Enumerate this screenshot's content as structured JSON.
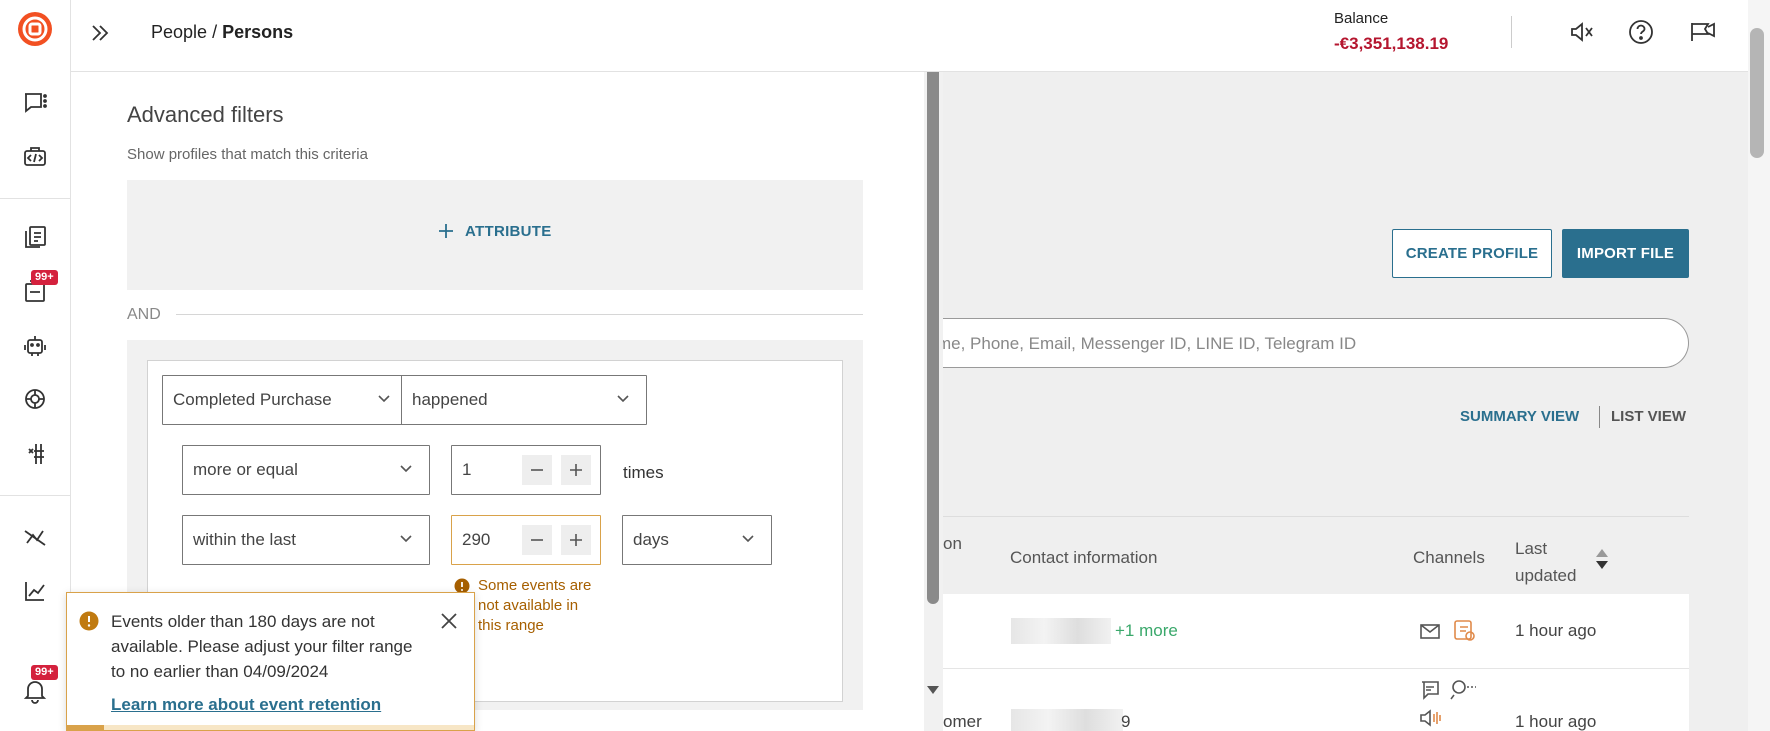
{
  "header": {
    "breadcrumb_parent": "People",
    "breadcrumb_sep": " / ",
    "breadcrumb_current": "Persons",
    "balance_label": "Balance",
    "balance_value": "-€3,351,138.19"
  },
  "rail": {
    "badges": [
      "99+",
      "99+"
    ]
  },
  "main": {
    "create_profile": "CREATE PROFILE",
    "import_file": "IMPORT FILE",
    "search_placeholder": "me, Phone, Email, Messenger ID, LINE ID, Telegram ID",
    "summary_view": "SUMMARY VIEW",
    "list_view": "LIST VIEW",
    "columns": [
      "on",
      "Contact information",
      "Channels",
      "Last updated"
    ],
    "rows": [
      {
        "name": "",
        "contact_suffix": "+1 more",
        "updated": "1 hour ago"
      },
      {
        "name": "omer",
        "contact_suffix": "9",
        "updated": "1 hour ago"
      }
    ]
  },
  "panel": {
    "title": "Advanced filters",
    "subtitle": "Show profiles that match this criteria",
    "attribute_button": "ATTRIBUTE",
    "and_label": "AND",
    "event_select": "Completed Purchase",
    "occurrence_select": "happened",
    "comparison_select": "more or equal",
    "count_value": "1",
    "times_label": "times",
    "time_select": "within the last",
    "range_value": "290",
    "unit_select": "days",
    "range_warning": "Some events are not available in this range"
  },
  "toast": {
    "message": "Events older than 180 days are not available. Please adjust your filter range to no earlier than 04/09/2024",
    "link": "Learn more about event retention",
    "progress": 0.09
  },
  "colors": {
    "accent": "#2a6f8e",
    "brand": "#f25022",
    "negative": "#b5162f",
    "warning": "#d9a24a"
  }
}
